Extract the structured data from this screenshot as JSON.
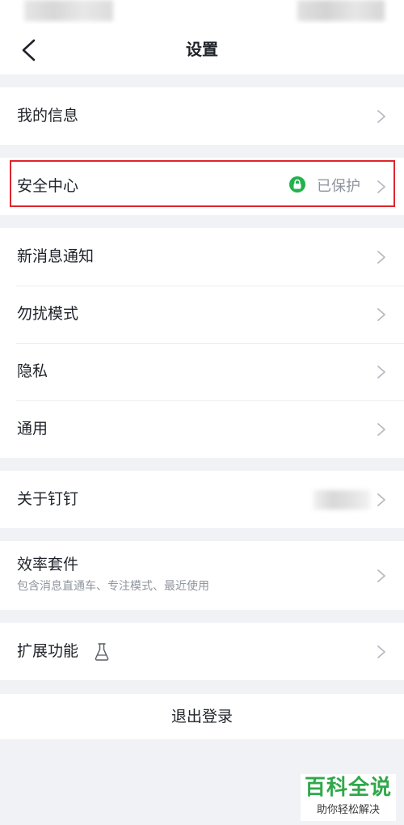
{
  "header": {
    "title": "设置",
    "back_icon": "chevron-left-icon"
  },
  "groups": {
    "my_info": {
      "label": "我的信息"
    },
    "security": {
      "label": "安全中心",
      "status": "已保护",
      "status_icon": "lock-icon",
      "status_color": "#22b14c",
      "highlight_color": "#e0262d"
    },
    "notifications": {
      "label": "新消息通知"
    },
    "dnd": {
      "label": "勿扰模式"
    },
    "privacy": {
      "label": "隐私"
    },
    "general": {
      "label": "通用"
    },
    "about": {
      "label": "关于钉钉"
    },
    "efficiency": {
      "label": "效率套件",
      "subtitle": "包含消息直通车、专注模式、最近使用"
    },
    "extensions": {
      "label": "扩展功能",
      "icon": "flask-icon"
    }
  },
  "logout": {
    "label": "退出登录"
  },
  "watermark": {
    "title": "百科全说",
    "subtitle": "助你轻松解决",
    "color": "#2fa84a"
  },
  "colors": {
    "background": "#f1f2f5",
    "text": "#1f2329",
    "secondary_text": "#8f959e",
    "chevron": "#b6bac0"
  }
}
